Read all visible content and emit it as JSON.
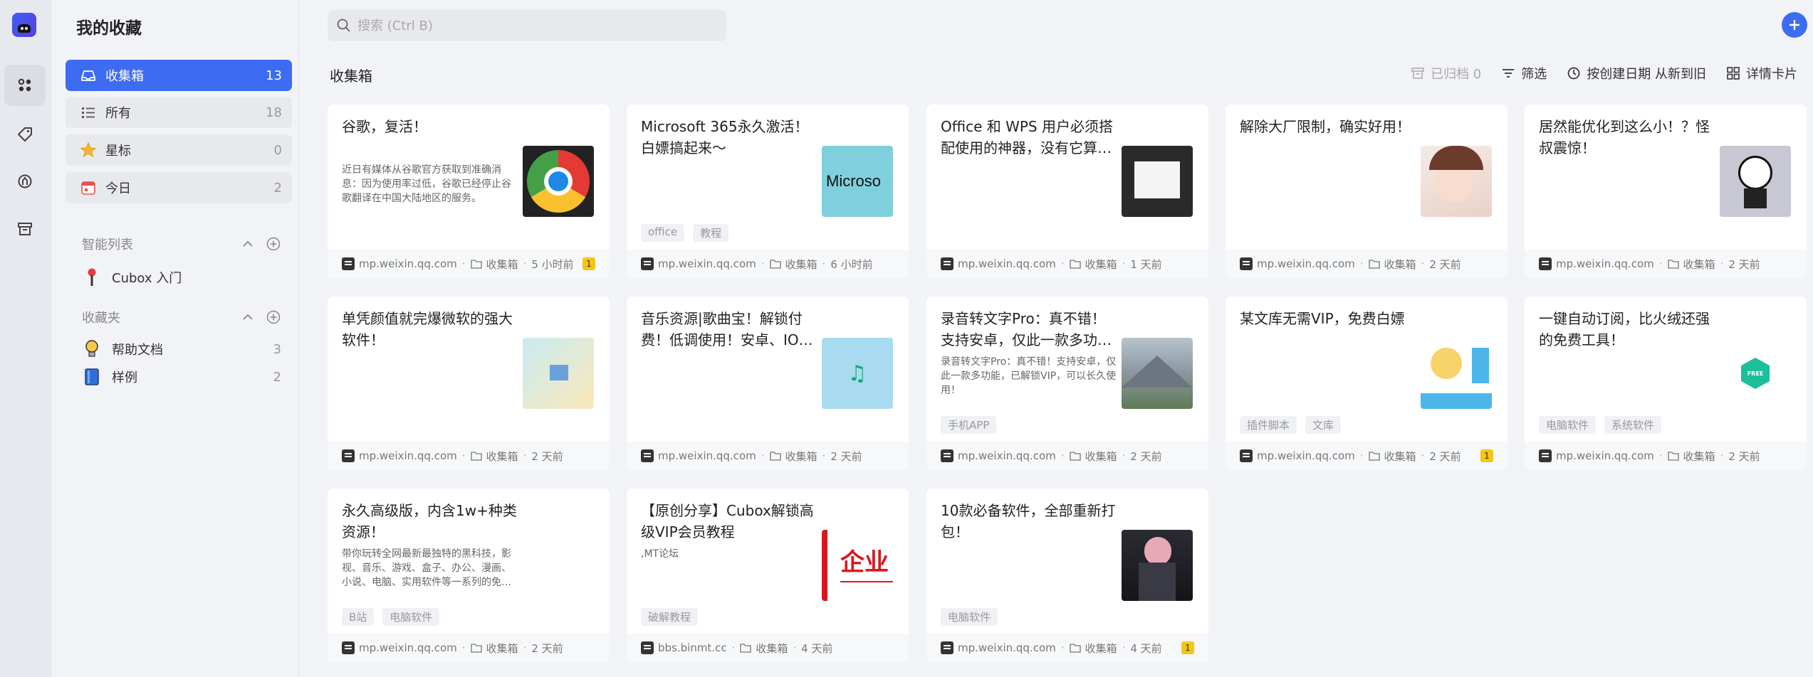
{
  "app": {
    "title": "我的收藏"
  },
  "search": {
    "placeholder": "搜索 (Ctrl B)"
  },
  "sidebar": {
    "nav": [
      {
        "label": "收集箱",
        "count": "13",
        "icon": "inbox-icon"
      },
      {
        "label": "所有",
        "count": "18",
        "icon": "list-icon"
      },
      {
        "label": "星标",
        "count": "0",
        "icon": "star-icon"
      },
      {
        "label": "今日",
        "count": "2",
        "icon": "calendar-icon"
      }
    ],
    "smart_lists": {
      "title": "智能列表",
      "items": [
        {
          "label": "Cubox 入门",
          "icon": "pin-icon"
        }
      ]
    },
    "folders": {
      "title": "收藏夹",
      "items": [
        {
          "label": "帮助文档",
          "count": "3",
          "icon": "bulb-icon"
        },
        {
          "label": "样例",
          "count": "2",
          "icon": "book-icon"
        }
      ]
    }
  },
  "main": {
    "title": "收集箱",
    "toolbar": {
      "archived": "已归档 0",
      "filter": "筛选",
      "sort": "按创建日期 从新到旧",
      "view": "详情卡片"
    }
  },
  "cards": [
    {
      "title": "谷歌，复活！",
      "desc": "近日有媒体从谷歌官方获取到准确消息：因为使用率过低，谷歌已经停止谷歌翻译在中国大陆地区的服务。",
      "tags": [],
      "site": "mp.weixin.qq.com",
      "folder": "收集箱",
      "time": "5 小时前",
      "badge": "1",
      "thumb": "chrome"
    },
    {
      "title": "Microsoft 365永久激活！白嫖搞起来～",
      "desc": "",
      "tags": [
        "office",
        "教程"
      ],
      "site": "mp.weixin.qq.com",
      "folder": "收集箱",
      "time": "6 小时前",
      "badge": "",
      "thumb": "microsoft",
      "thumb_text": "Microso"
    },
    {
      "title": "Office 和 WPS 用户必须搭配使用的神器，没有它算…",
      "desc": "",
      "tags": [],
      "site": "mp.weixin.qq.com",
      "folder": "收集箱",
      "time": "1 天前",
      "badge": "",
      "thumb": "paper"
    },
    {
      "title": "解除大厂限制，确实好用！",
      "desc": "",
      "tags": [],
      "site": "mp.weixin.qq.com",
      "folder": "收集箱",
      "time": "2 天前",
      "badge": "",
      "thumb": "girl"
    },
    {
      "title": "居然能优化到这么小！？怪叔震惊！",
      "desc": "",
      "tags": [],
      "site": "mp.weixin.qq.com",
      "folder": "收集箱",
      "time": "2 天前",
      "badge": "",
      "thumb": "meme"
    },
    {
      "title": "单凭颜值就完爆微软的强大软件！",
      "desc": "",
      "tags": [],
      "site": "mp.weixin.qq.com",
      "folder": "收集箱",
      "time": "2 天前",
      "badge": "",
      "thumb": "pastel"
    },
    {
      "title": "音乐资源|歌曲宝！解锁付费！低调使用！安卓、IO…",
      "desc": "",
      "tags": [],
      "site": "mp.weixin.qq.com",
      "folder": "收集箱",
      "time": "2 天前",
      "badge": "",
      "thumb": "music"
    },
    {
      "title": "录音转文字Pro：真不错！支持安卓，仅此一款多功…",
      "desc": "录音转文字Pro：真不错！支持安卓，仅此一款多功能，已解锁VIP，可以长久使用！",
      "tags": [
        "手机APP"
      ],
      "site": "mp.weixin.qq.com",
      "folder": "收集箱",
      "time": "2 天前",
      "badge": "",
      "thumb": "mountain"
    },
    {
      "title": "某文库无需VIP，免费白嫖",
      "desc": "",
      "tags": [
        "插件脚本",
        "文库"
      ],
      "site": "mp.weixin.qq.com",
      "folder": "收集箱",
      "time": "2 天前",
      "badge": "1",
      "thumb": "cartoon"
    },
    {
      "title": "一键自动订阅，比火绒还强的免费工具！",
      "desc": "",
      "tags": [
        "电脑软件",
        "系统软件"
      ],
      "site": "mp.weixin.qq.com",
      "folder": "收集箱",
      "time": "2 天前",
      "badge": "",
      "thumb": "hex",
      "thumb_text": "FREE"
    },
    {
      "title": "永久高级版，内含1w+种类资源！",
      "desc": "带你玩转全网最新最独特的黑科技，影视、音乐、游戏、盒子、办公、漫画、小说、电脑、实用软件等一系列的免费使用学习资源，全程免费飙车",
      "tags": [
        "B站",
        "电脑软件"
      ],
      "site": "mp.weixin.qq.com",
      "folder": "收集箱",
      "time": "2 天前",
      "badge": "",
      "thumb": ""
    },
    {
      "title": "【原创分享】Cubox解锁高级VIP会员教程",
      "desc": ",MT论坛",
      "tags": [
        "破解教程"
      ],
      "site": "bbs.binmt.cc",
      "folder": "收集箱",
      "time": "4 天前",
      "badge": "",
      "thumb": "red",
      "thumb_text": "企业"
    },
    {
      "title": "10款必备软件，全部重新打包！",
      "desc": "",
      "tags": [
        "电脑软件"
      ],
      "site": "mp.weixin.qq.com",
      "folder": "收集箱",
      "time": "4 天前",
      "badge": "1",
      "thumb": "dark"
    }
  ],
  "colors": {
    "accent": "#3d6bf1",
    "badge": "#f5c518"
  }
}
